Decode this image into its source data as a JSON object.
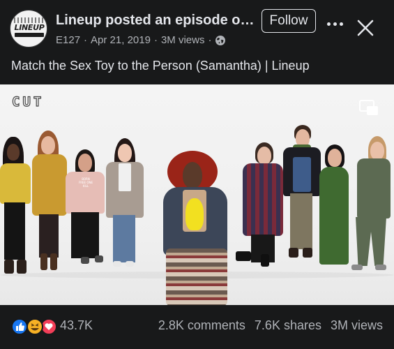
{
  "header": {
    "avatar_text": "LINEUP",
    "title": "Lineup posted an episode of...",
    "episode": "E127",
    "date": "Apr 21, 2019",
    "views": "3M views",
    "follow_label": "Follow",
    "icons": {
      "privacy": "globe-icon",
      "more": "more-icon",
      "close": "close-icon"
    }
  },
  "caption": "Match the Sex Toy to the Person (Samantha) | Lineup",
  "video": {
    "watermark": "CUT",
    "shirt_text": "BORN FREE ONE KILL",
    "icons": {
      "pip": "picture-in-picture-icon"
    }
  },
  "footer": {
    "reaction_icons": [
      "like-icon",
      "haha-icon",
      "love-icon"
    ],
    "reaction_count": "43.7K",
    "comments": "2.8K comments",
    "shares": "7.6K shares",
    "views": "3M views"
  },
  "colors": {
    "background": "#18191a",
    "text_primary": "#e4e6eb",
    "text_secondary": "#b0b3b8",
    "like_blue": "#1877f2",
    "love_red": "#f33e58",
    "haha_yellow": "#f7b125"
  }
}
